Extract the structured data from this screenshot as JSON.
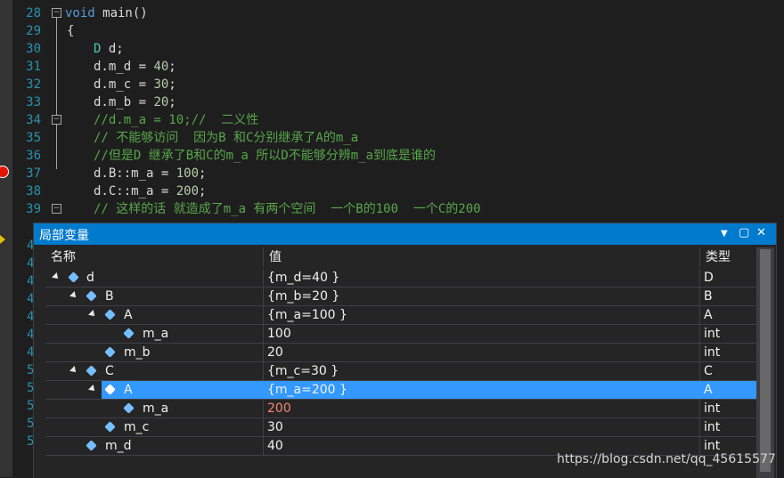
{
  "editor": {
    "line_numbers": [
      "28",
      "29",
      "30",
      "31",
      "32",
      "33",
      "34",
      "35",
      "36",
      "37",
      "38",
      "39"
    ],
    "lines": {
      "l28_kw": "void",
      "l28_rest": " main()",
      "l29": "{",
      "l30_type": "D",
      "l30_rest": " d;",
      "l31_id": "d.m_d = ",
      "l31_num": "40",
      "l31_end": ";",
      "l32_id": "d.m_c = ",
      "l32_num": "30",
      "l32_end": ";",
      "l33_id": "d.m_b = ",
      "l33_num": "20",
      "l33_end": ";",
      "l34": "//d.m_a = 10;//  二义性",
      "l35": "// 不能够访问  因为B 和C分别继承了A的m_a",
      "l36": "//但是D 继承了B和C的m_a 所以D不能够分辨m_a到底是谁的",
      "l37_id": "d.B::m_a = ",
      "l37_num": "100",
      "l37_end": ";",
      "l38_id": "d.C::m_a = ",
      "l38_num": "200",
      "l38_end": ";",
      "l39": "// 这样的话 就造成了m_a 有两个空间  一个B的100  一个C的200"
    },
    "partial_line_numbers": [
      "4",
      "4",
      "4",
      "4",
      "4",
      "4",
      "4",
      "5",
      "5",
      "5",
      "5",
      "5"
    ]
  },
  "locals": {
    "title": "局部变量",
    "headers": {
      "name": "名称",
      "value": "值",
      "type": "类型"
    },
    "rows": [
      {
        "name": "d",
        "value": "{m_d=40 }",
        "type": "D"
      },
      {
        "name": "B",
        "value": "{m_b=20 }",
        "type": "B"
      },
      {
        "name": "A",
        "value": "{m_a=100 }",
        "type": "A"
      },
      {
        "name": "m_a",
        "value": "100",
        "type": "int"
      },
      {
        "name": "m_b",
        "value": "20",
        "type": "int"
      },
      {
        "name": "C",
        "value": "{m_c=30 }",
        "type": "C"
      },
      {
        "name": "A",
        "value": "{m_a=200 }",
        "type": "A"
      },
      {
        "name": "m_a",
        "value": "200",
        "type": "int"
      },
      {
        "name": "m_c",
        "value": "30",
        "type": "int"
      },
      {
        "name": "m_d",
        "value": "40",
        "type": "int"
      }
    ]
  },
  "watermark": "https://blog.csdn.net/qq_45615577",
  "colors": {
    "accent": "#007acc",
    "selection": "#3399ff",
    "changed_value": "#f48771"
  }
}
